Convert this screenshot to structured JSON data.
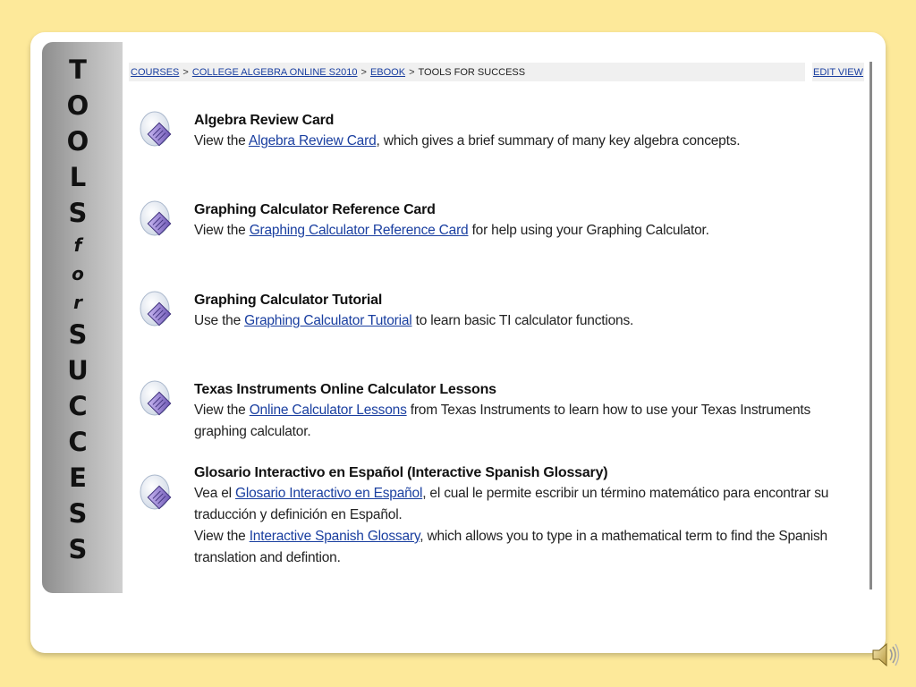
{
  "sidebar": {
    "letters": [
      "T",
      "O",
      "O",
      "L",
      "S",
      "f",
      "o",
      "r",
      "S",
      "U",
      "C",
      "C",
      "E",
      "S",
      "S"
    ],
    "small_letters_indexes": [
      5,
      6,
      7
    ]
  },
  "breadcrumb": {
    "items": [
      {
        "label": "COURSES",
        "link": true
      },
      {
        "label": "COLLEGE ALGEBRA ONLINE S2010",
        "link": true
      },
      {
        "label": "EBOOK",
        "link": true
      },
      {
        "label": "TOOLS FOR SUCCESS",
        "link": false
      }
    ],
    "separator": ">",
    "edit_view": "EDIT VIEW"
  },
  "items": [
    {
      "title": "Algebra Review Card",
      "lines": [
        [
          {
            "t": "View the "
          },
          {
            "t": "Algebra Review Card",
            "link": true
          },
          {
            "t": ", which gives a brief summary of many key algebra concepts."
          }
        ]
      ]
    },
    {
      "title": "Graphing Calculator Reference Card",
      "lines": [
        [
          {
            "t": "View the "
          },
          {
            "t": "Graphing Calculator Reference Card",
            "link": true
          },
          {
            "t": " for help using your Graphing Calculator."
          }
        ]
      ]
    },
    {
      "title": "Graphing Calculator Tutorial",
      "lines": [
        [
          {
            "t": "Use the "
          },
          {
            "t": "Graphing Calculator Tutorial",
            "link": true
          },
          {
            "t": " to learn basic TI calculator functions."
          }
        ]
      ]
    },
    {
      "title": "Texas Instruments Online Calculator Lessons",
      "lines": [
        [
          {
            "t": "View the "
          },
          {
            "t": "Online Calculator Lessons",
            "link": true
          },
          {
            "t": " from Texas Instruments to learn how to use your Texas Instruments graphing calculator."
          }
        ]
      ]
    },
    {
      "title": "Glosario Interactivo en Español (Interactive Spanish Glossary)",
      "lines": [
        [
          {
            "t": "Vea el "
          },
          {
            "t": "Glosario Interactivo en Español",
            "link": true
          },
          {
            "t": ", el cual le permite escribir un término matemático para encontrar su traducción y definición en Español."
          }
        ],
        [
          {
            "t": "View the "
          },
          {
            "t": "Interactive Spanish Glossary",
            "link": true
          },
          {
            "t": ", which allows you to type in a mathematical term to find the Spanish translation and defintion."
          }
        ]
      ]
    }
  ],
  "icons": {
    "item_icon": "document-icon",
    "speaker_icon": "speaker-icon"
  },
  "colors": {
    "background": "#fde99a",
    "link": "#1a3fa0",
    "icon_purple": "#8e7ccc"
  }
}
